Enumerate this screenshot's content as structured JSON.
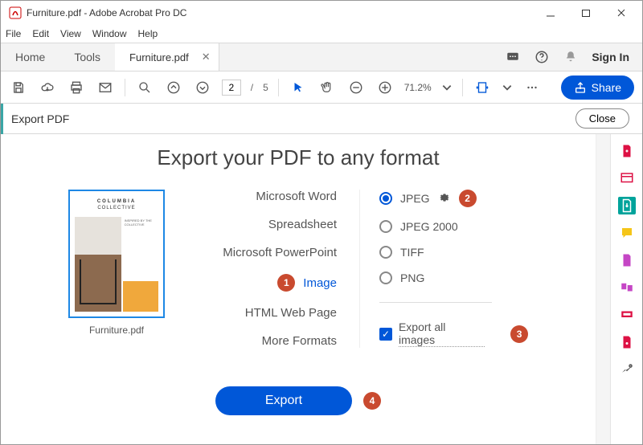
{
  "app": {
    "title": "Furniture.pdf - Adobe Acrobat Pro DC"
  },
  "menu": [
    "File",
    "Edit",
    "View",
    "Window",
    "Help"
  ],
  "tabs": {
    "home": "Home",
    "tools": "Tools",
    "doc": "Furniture.pdf",
    "signin": "Sign In"
  },
  "toolbar": {
    "page_current": "2",
    "page_sep": "/",
    "page_total": "5",
    "zoom": "71.2%",
    "share": "Share"
  },
  "exportbar": {
    "title": "Export PDF",
    "close": "Close"
  },
  "heading": "Export your PDF to any format",
  "thumb": {
    "title": "COLUMBIA",
    "subtitle": "COLLECTIVE",
    "caption": "Furniture.pdf"
  },
  "format_list": {
    "word": "Microsoft Word",
    "spreadsheet": "Spreadsheet",
    "ppt": "Microsoft PowerPoint",
    "image": "Image",
    "html": "HTML Web Page",
    "more": "More Formats"
  },
  "image_options": {
    "jpeg": "JPEG",
    "jpeg2000": "JPEG 2000",
    "tiff": "TIFF",
    "png": "PNG",
    "export_all": "Export all images"
  },
  "badges": {
    "one": "1",
    "two": "2",
    "three": "3",
    "four": "4"
  },
  "export_button": "Export"
}
